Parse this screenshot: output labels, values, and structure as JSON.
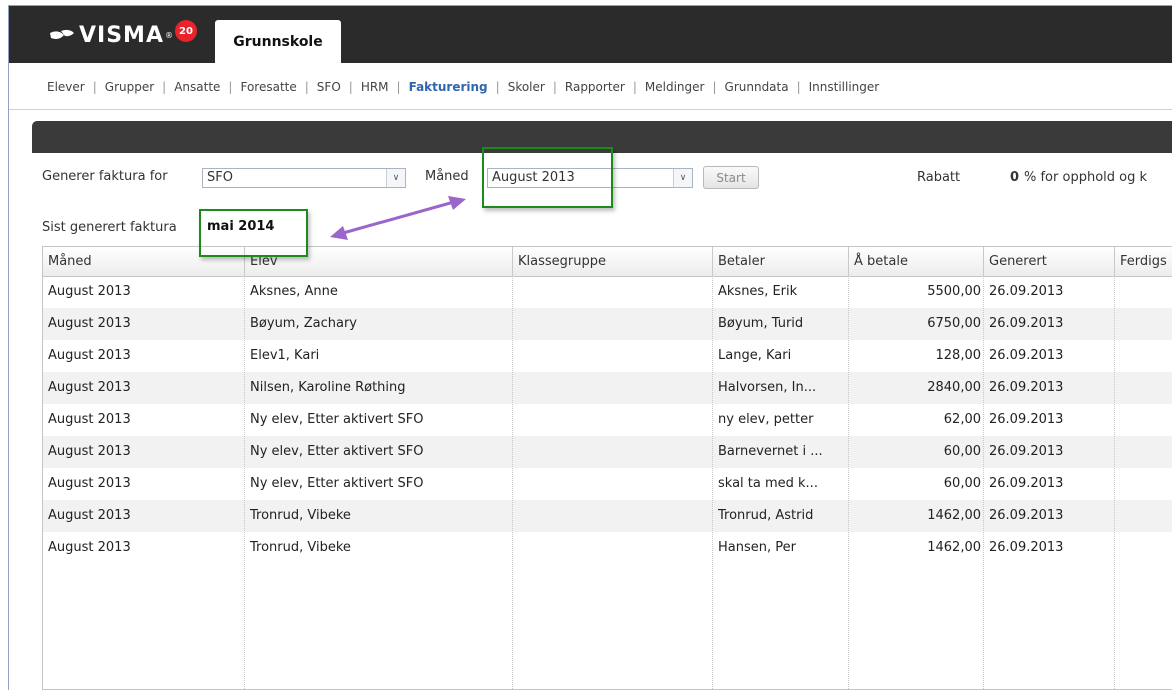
{
  "brand": {
    "name": "VISMA",
    "badge": "20"
  },
  "app_tab": "Grunnskole",
  "nav": [
    {
      "label": "Elever",
      "active": false
    },
    {
      "label": "Grupper",
      "active": false
    },
    {
      "label": "Ansatte",
      "active": false
    },
    {
      "label": "Foresatte",
      "active": false
    },
    {
      "label": "SFO",
      "active": false
    },
    {
      "label": "HRM",
      "active": false
    },
    {
      "label": "Fakturering",
      "active": true
    },
    {
      "label": "Skoler",
      "active": false
    },
    {
      "label": "Rapporter",
      "active": false
    },
    {
      "label": "Meldinger",
      "active": false
    },
    {
      "label": "Grunndata",
      "active": false
    },
    {
      "label": "Innstillinger",
      "active": false
    }
  ],
  "form": {
    "generer_label": "Generer faktura for",
    "generer_value": "SFO",
    "maned_label": "Måned",
    "maned_value": "August 2013",
    "start_label": "Start",
    "rabatt_label": "Rabatt",
    "rabatt_value": "0",
    "rabatt_suffix": "% for opphold og k",
    "sist_label": "Sist generert faktura",
    "sist_value": "mai 2014"
  },
  "table": {
    "columns": [
      "Måned",
      "Elev",
      "Klassegruppe",
      "Betaler",
      "Å betale",
      "Generert",
      "Ferdigs"
    ],
    "rows": [
      [
        "August 2013",
        "Aksnes, Anne",
        "",
        "Aksnes, Erik",
        "5500,00",
        "26.09.2013",
        ""
      ],
      [
        "August 2013",
        "Bøyum, Zachary",
        "",
        "Bøyum, Turid",
        "6750,00",
        "26.09.2013",
        ""
      ],
      [
        "August 2013",
        "Elev1, Kari",
        "",
        "Lange, Kari",
        "128,00",
        "26.09.2013",
        ""
      ],
      [
        "August 2013",
        "Nilsen, Karoline Røthing",
        "",
        "Halvorsen, In...",
        "2840,00",
        "26.09.2013",
        ""
      ],
      [
        "August 2013",
        "Ny elev, Etter aktivert SFO",
        "",
        "ny elev, petter",
        "62,00",
        "26.09.2013",
        ""
      ],
      [
        "August 2013",
        "Ny elev, Etter aktivert SFO",
        "",
        "Barnevernet i ...",
        "60,00",
        "26.09.2013",
        ""
      ],
      [
        "August 2013",
        "Ny elev, Etter aktivert SFO",
        "",
        "skal ta med k...",
        "60,00",
        "26.09.2013",
        ""
      ],
      [
        "August 2013",
        "Tronrud, Vibeke",
        "",
        "Tronrud, Astrid",
        "1462,00",
        "26.09.2013",
        ""
      ],
      [
        "August 2013",
        "Tronrud, Vibeke",
        "",
        "Hansen, Per",
        "1462,00",
        "26.09.2013",
        ""
      ]
    ]
  },
  "colors": {
    "header_bg": "#2b2b2b",
    "nav_active": "#2f66b0",
    "highlight_box": "#1e8a1e",
    "annotation_arrow": "#9966cc",
    "badge": "#e8232c"
  }
}
